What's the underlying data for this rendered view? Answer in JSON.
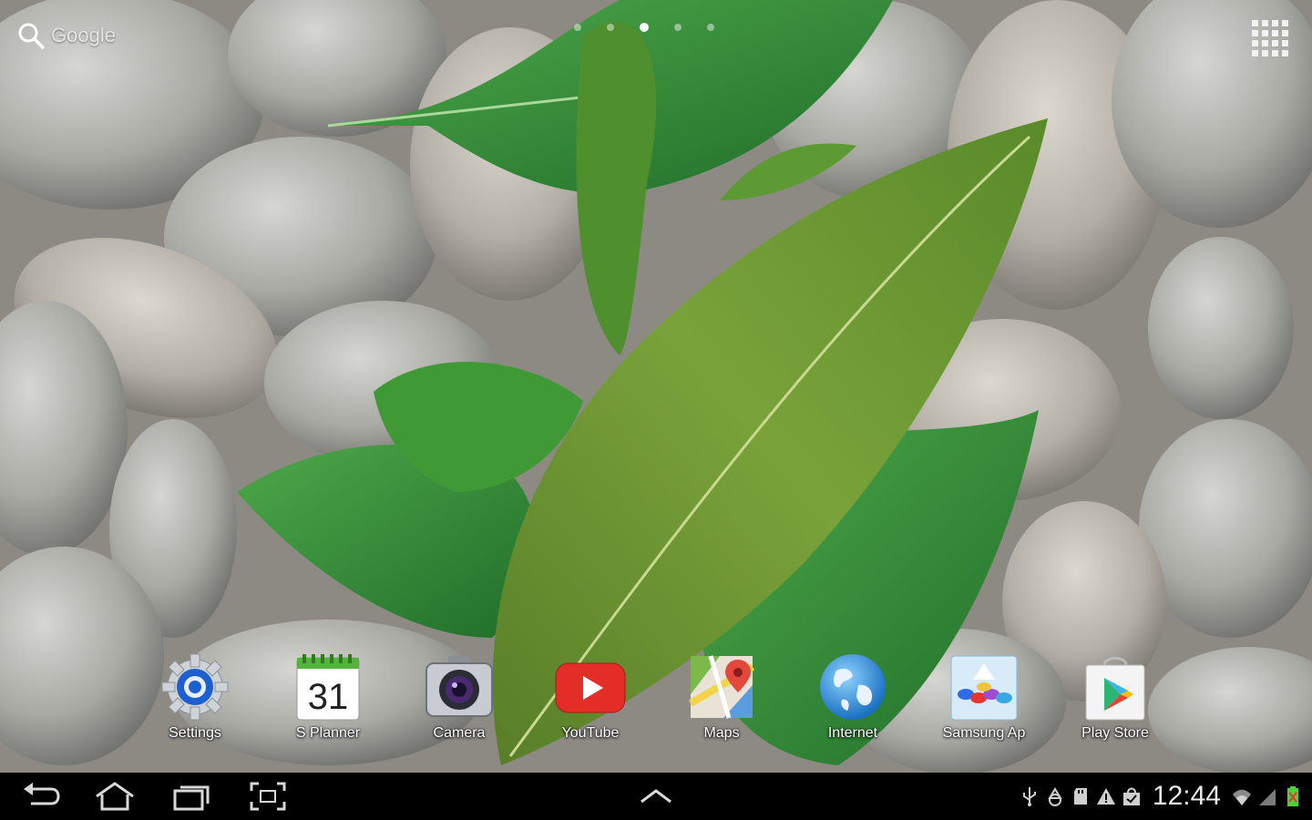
{
  "home": {
    "search_label": "Google",
    "page_indicator": {
      "count": 5,
      "active": 3
    },
    "apps_button_icon": "apps-grid-icon"
  },
  "dock": {
    "apps": [
      {
        "label": "Settings",
        "icon": "settings-gear-icon"
      },
      {
        "label": "S Planner",
        "icon": "calendar-icon",
        "calendar_day": "31"
      },
      {
        "label": "Camera",
        "icon": "camera-icon"
      },
      {
        "label": "YouTube",
        "icon": "youtube-play-icon",
        "brand_color": "#e52d27"
      },
      {
        "label": "Maps",
        "icon": "maps-icon"
      },
      {
        "label": "Internet",
        "icon": "globe-icon"
      },
      {
        "label": "Samsung Ap",
        "icon": "samsung-apps-icon"
      },
      {
        "label": "Play Store",
        "icon": "play-store-icon"
      }
    ]
  },
  "navbar": {
    "buttons": [
      "back-icon",
      "home-icon",
      "recent-apps-icon",
      "screenshot-icon",
      "chevron-up-icon"
    ],
    "status": {
      "time": "12:44",
      "icons": [
        "usb-icon",
        "recycle-icon",
        "sd-card-icon",
        "warning-icon",
        "shopping-bag-icon",
        "wifi-icon",
        "signal-icon",
        "battery-icon"
      ],
      "battery_color": "#4cd137"
    }
  },
  "wallpaper": {
    "description_icon": "stones-leaves-wallpaper"
  }
}
